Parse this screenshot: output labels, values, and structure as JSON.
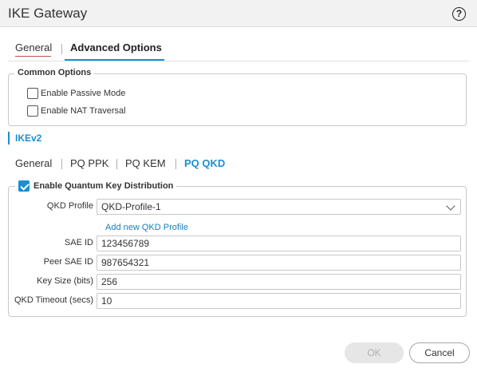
{
  "window": {
    "title": "IKE Gateway"
  },
  "tabs": [
    {
      "label": "General",
      "active": false
    },
    {
      "label": "Advanced Options",
      "active": true
    }
  ],
  "common_options": {
    "legend": "Common Options",
    "enable_passive_mode": {
      "label": "Enable Passive Mode",
      "checked": false
    },
    "enable_nat_traversal": {
      "label": "Enable NAT Traversal",
      "checked": false
    }
  },
  "section_label": "IKEv2",
  "subtabs": [
    {
      "label": "General",
      "active": false
    },
    {
      "label": "PQ PPK",
      "active": false
    },
    {
      "label": "PQ KEM",
      "active": false
    },
    {
      "label": "PQ QKD",
      "active": true
    }
  ],
  "qkd": {
    "legend": "Enable Quantum Key Distribution",
    "enabled": true,
    "profile_label": "QKD Profile",
    "profile_value": "QKD-Profile-1",
    "add_profile_link": "Add new QKD Profile",
    "sae_id_label": "SAE ID",
    "sae_id_value": "123456789",
    "peer_sae_id_label": "Peer SAE ID",
    "peer_sae_id_value": "987654321",
    "key_size_label": "Key Size (bits)",
    "key_size_value": "256",
    "timeout_label": "QKD Timeout (secs)",
    "timeout_value": "10"
  },
  "buttons": {
    "ok": "OK",
    "cancel": "Cancel",
    "ok_enabled": false
  },
  "colors": {
    "accent": "#1a8fd1",
    "tab_underline": "#c0504d"
  },
  "icons": {
    "help": "help-icon",
    "dropdown": "chevron-down-icon",
    "check": "checkmark-icon"
  }
}
